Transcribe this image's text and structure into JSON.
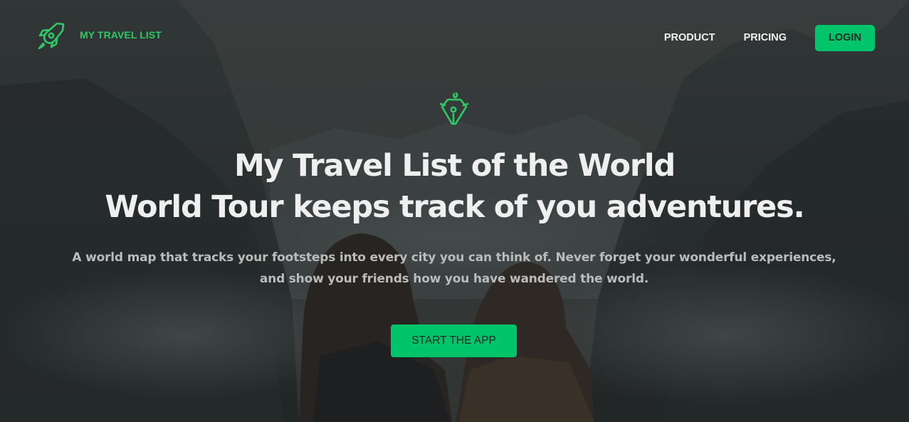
{
  "brand": {
    "name": "MY TRAVEL LIST",
    "icon": "rocket-icon",
    "accent_color": "#00c46a"
  },
  "nav": {
    "links": [
      "PRODUCT",
      "PRICING"
    ],
    "login_label": "LOGIN"
  },
  "hero": {
    "icon": "rocket-icon",
    "headline_line1": "My Travel List of the World",
    "headline_line2": "World Tour keeps track of you adventures.",
    "description": "A world map that tracks your footsteps into every city you can think of. Never forget your wonderful experiences, and show your friends how you have wandered the world.",
    "cta_label": "START THE APP",
    "background": "mountain-valley-photo"
  }
}
